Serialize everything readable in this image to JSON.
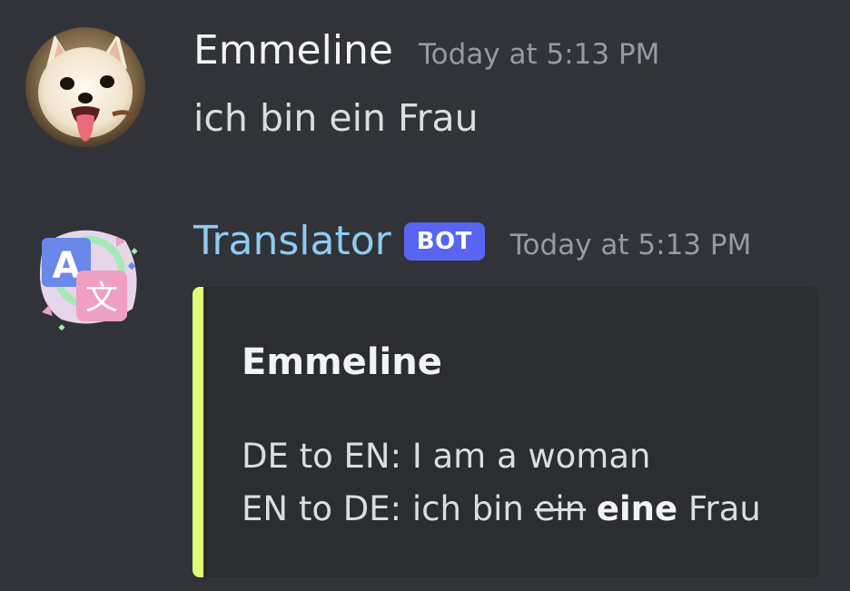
{
  "messages": [
    {
      "username": "Emmeline",
      "timestamp": "Today at 5:13 PM",
      "text": "ich bin ein Frau",
      "avatar": "fox-puppy-avatar"
    },
    {
      "username": "Translator",
      "badge": "BOT",
      "timestamp": "Today at 5:13 PM",
      "avatar": "translate-icon",
      "embed": {
        "accent_color": "#e0ff75",
        "title": "Emmeline",
        "line1": "DE to EN: I am a woman",
        "line2_prefix": "EN to DE: ich bin ",
        "line2_removed": "ein",
        "line2_added": "eine",
        "line2_suffix": "Frau"
      }
    }
  ],
  "colors": {
    "background": "#313338",
    "bot_name": "#8fcbf2",
    "bot_badge": "#5865f2",
    "embed_bg": "#2b2d31"
  }
}
